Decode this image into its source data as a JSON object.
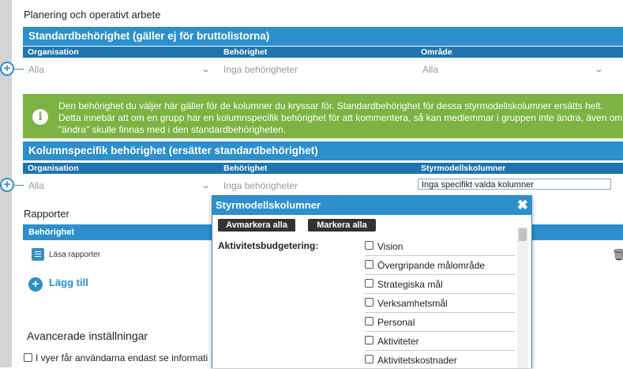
{
  "section_title": "Planering och operativt arbete",
  "standard": {
    "header": "Standardbehörighet (gäller ej för bruttolistorna)",
    "columns": [
      "Organisation",
      "Behörighet",
      "Område"
    ],
    "row": {
      "organisation": "Alla",
      "behorighet": "Inga behörigheter",
      "omrade": "Alla"
    }
  },
  "info_text": [
    "Den behörighet du väljer här gäller för de kolumner du kryssar för. Standardbehörighet för dessa styrmodellskolumner ersätts helt.",
    "Detta innebär att om en grupp har en kolumnspecifik behörighet för att kommentera, så kan medlemmar i gruppen inte ändra, även om",
    "\"ändra\" skulle finnas med i den standardbehörigheten."
  ],
  "kolumn": {
    "header": "Kolumnspecifik behörighet (ersätter standardbehörighet)",
    "columns": [
      "Organisation",
      "Behörighet",
      "Styrmodellskolumner"
    ],
    "row": {
      "organisation": "Alla",
      "behorighet": "Inga behörigheter",
      "styrmodell_value": "Inga specifikt valda kolumner"
    }
  },
  "rapporter": {
    "title": "Rapporter",
    "header": "Behörighet",
    "item": "Läsa rapporter",
    "add": "Lägg till"
  },
  "advanced": {
    "title": "Avancerade inställningar",
    "checkbox_label": "I vyer får användarna endast se informati"
  },
  "popup": {
    "title": "Styrmodellskolumner",
    "btn_unmark": "Avmarkera alla",
    "btn_mark": "Markera alla",
    "group_label": "Aktivitetsbudgetering:",
    "options": [
      "Vision",
      "Övergripande målområde",
      "Strategiska mål",
      "Verksamhetsmål",
      "Personal",
      "Aktiviteter",
      "Aktivitetskostnader"
    ]
  },
  "colors": {
    "accent": "#2d8fcb",
    "accent_dark": "#1f74ad",
    "info_green": "#7cb342"
  },
  "icons": [
    "plus-circle-icon",
    "chevron-down-icon",
    "info-icon",
    "book-icon",
    "trash-icon",
    "close-icon",
    "checkbox-icon"
  ]
}
